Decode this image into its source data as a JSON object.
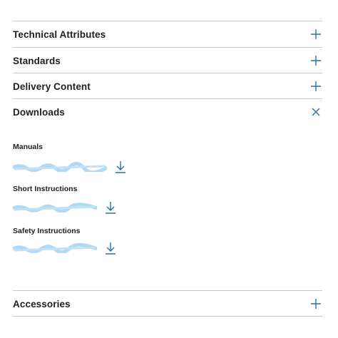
{
  "sections": [
    {
      "label": "Technical Attributes",
      "state": "collapsed",
      "icon": "plus-icon"
    },
    {
      "label": "Standards",
      "state": "collapsed",
      "icon": "plus-icon"
    },
    {
      "label": "Delivery Content",
      "state": "collapsed",
      "icon": "plus-icon"
    },
    {
      "label": "Downloads",
      "state": "expanded",
      "icon": "close-icon"
    },
    {
      "label": "Accessories",
      "state": "collapsed",
      "icon": "plus-icon"
    }
  ],
  "downloads": {
    "groups": [
      {
        "title": "Manuals",
        "link_text": "",
        "icon": "download-icon"
      },
      {
        "title": "Short Instructions",
        "link_text": "",
        "icon": "download-icon"
      },
      {
        "title": "Safety Instructions",
        "link_text": "",
        "icon": "download-icon"
      }
    ]
  },
  "colors": {
    "accent": "#2a6fa8",
    "link": "#5aa8de",
    "divider": "#c8c8c8",
    "text": "#1e1e1e"
  }
}
